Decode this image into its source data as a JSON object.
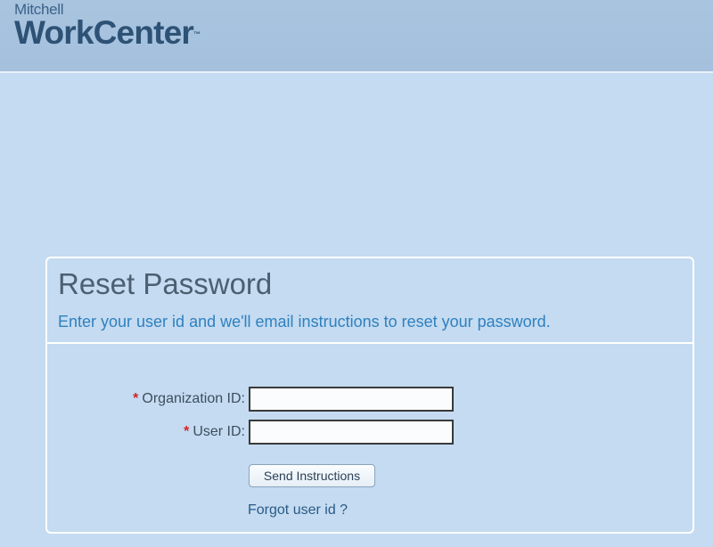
{
  "header": {
    "brand_small": "Mitchell",
    "brand_main": "WorkCenter",
    "brand_mark": "™"
  },
  "panel": {
    "title": "Reset Password",
    "subtitle": "Enter your user id and we'll email instructions to reset your password."
  },
  "form": {
    "required_marker": "*",
    "organization_id": {
      "label": "Organization ID:",
      "value": ""
    },
    "user_id": {
      "label": "User ID:",
      "value": ""
    },
    "submit_label": "Send Instructions",
    "forgot_link": "Forgot user id ?"
  },
  "colors": {
    "background": "#c4dbf1",
    "header": "#a6c1de",
    "title": "#4c5f71",
    "subtitle": "#2f80bf",
    "required": "#d4242a",
    "link": "#2a5a86"
  }
}
